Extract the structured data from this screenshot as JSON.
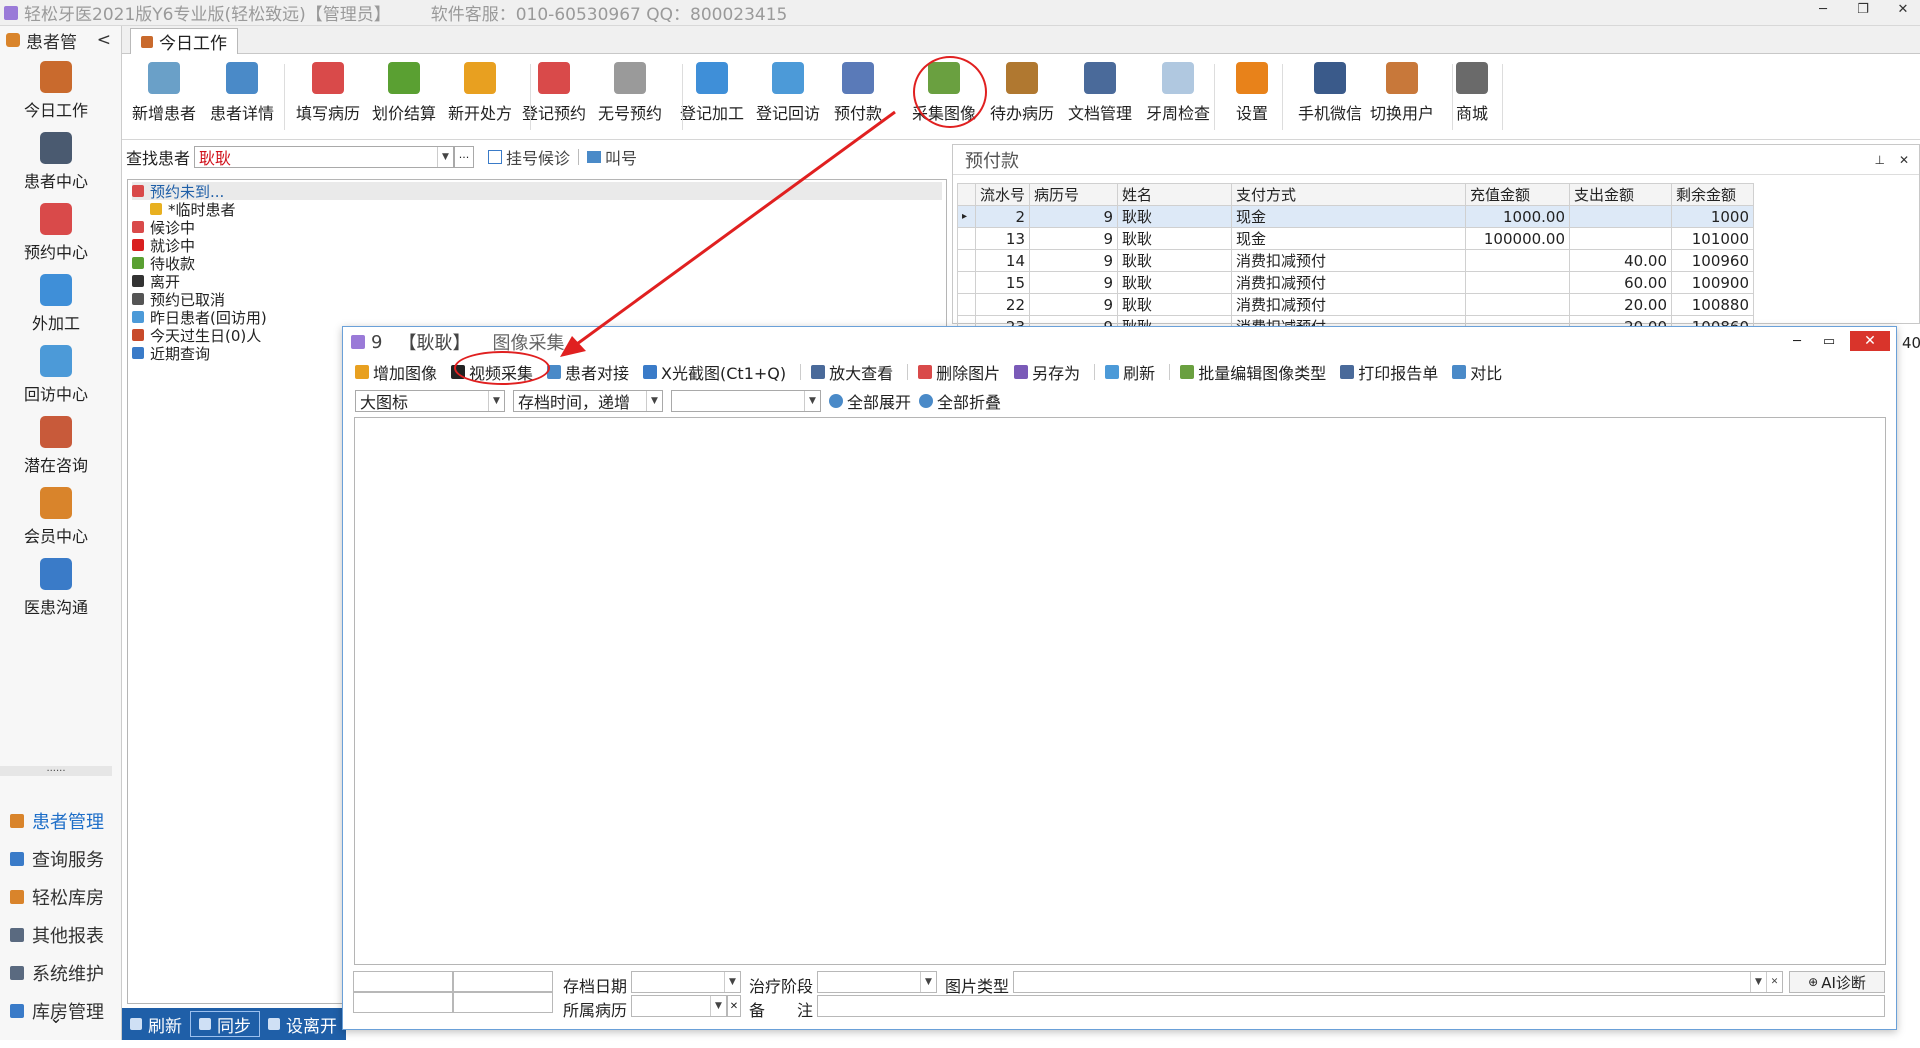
{
  "app": {
    "title": "轻松牙医2021版Y6专业版(轻松致远)【管理员】",
    "support": "软件客服：010-60530967 QQ：800023415",
    "window_controls": [
      "─",
      "❐",
      "✕"
    ]
  },
  "left_panel": {
    "header": "患者管",
    "header_arrow": "<",
    "nav_big": [
      {
        "label": "今日工作",
        "icon": "worker-icon",
        "color": "#c96a2d"
      },
      {
        "label": "患者中心",
        "icon": "binoculars-icon",
        "color": "#4a5a70"
      },
      {
        "label": "预约中心",
        "icon": "calendar-icon",
        "color": "#d94a4a"
      },
      {
        "label": "外加工",
        "icon": "cubes-icon",
        "color": "#3f8fd8"
      },
      {
        "label": "回访中心",
        "icon": "refresh-icon",
        "color": "#4c9ad8"
      },
      {
        "label": "潜在咨询",
        "icon": "consult-icon",
        "color": "#c85a3a"
      },
      {
        "label": "会员中心",
        "icon": "members-icon",
        "color": "#d9842b"
      },
      {
        "label": "医患沟通",
        "icon": "film-icon",
        "color": "#3a7bc8"
      }
    ],
    "dots": "......",
    "nav_small": [
      {
        "label": "患者管理",
        "icon": "people-icon",
        "color": "#d9842b",
        "active": true
      },
      {
        "label": "查询服务",
        "icon": "query-icon",
        "color": "#3a7bc8"
      },
      {
        "label": "轻松库房",
        "icon": "warehouse-icon",
        "color": "#d9842b"
      },
      {
        "label": "其他报表",
        "icon": "report-icon",
        "color": "#5a6a80"
      },
      {
        "label": "系统维护",
        "icon": "maintenance-icon",
        "color": "#5a6a80"
      },
      {
        "label": "库房管理",
        "icon": "stock-icon",
        "color": "#3a7bc8"
      }
    ],
    "bottom_arrow": "⌄"
  },
  "tabs": [
    {
      "label": "今日工作"
    }
  ],
  "ribbon": [
    {
      "label": "新增患者",
      "icon": "add-patient-icon",
      "color": "#6aa0c8"
    },
    {
      "label": "患者详情",
      "icon": "patient-detail-icon",
      "color": "#4a8ac8"
    },
    {
      "label": "填写病历",
      "icon": "medical-record-icon",
      "color": "#d94a4a"
    },
    {
      "label": "划价结算",
      "icon": "yen-icon",
      "color": "#5aa032"
    },
    {
      "label": "新开处方",
      "icon": "pill-icon",
      "color": "#e8a020"
    },
    {
      "label": "登记预约",
      "icon": "calendar-icon",
      "color": "#d94a4a"
    },
    {
      "label": "无号预约",
      "icon": "calendar-grid-icon",
      "color": "#9a9a9a"
    },
    {
      "label": "登记加工",
      "icon": "cubes-icon",
      "color": "#3f8fd8"
    },
    {
      "label": "登记回访",
      "icon": "refresh-icon",
      "color": "#4c9ad8"
    },
    {
      "label": "预付款",
      "icon": "prepay-icon",
      "color": "#5a7ab8"
    },
    {
      "label": "采集图像",
      "icon": "image-icon",
      "color": "#6aa040"
    },
    {
      "label": "待办病历",
      "icon": "checklist-icon",
      "color": "#b07830"
    },
    {
      "label": "文档管理",
      "icon": "document-icon",
      "color": "#4a6a9a"
    },
    {
      "label": "牙周检查",
      "icon": "tooth-icon",
      "color": "#b0c8e0"
    },
    {
      "label": "设置",
      "icon": "rss-settings-icon",
      "color": "#e8821a"
    },
    {
      "label": "手机微信",
      "icon": "phone-icon",
      "color": "#3a5a8a"
    },
    {
      "label": "切换用户",
      "icon": "switch-user-icon",
      "color": "#c8783a"
    },
    {
      "label": "商城",
      "icon": "cart-icon",
      "color": "#6a6a6a"
    }
  ],
  "find": {
    "label": "查找患者",
    "value": "耿耿",
    "dropdown": "▼",
    "ellipsis": "···",
    "queue": "挂号候诊",
    "call": "叫号"
  },
  "tree": [
    {
      "label": "预约未到...",
      "icon": "appointment-icon",
      "color": "#d94a4a",
      "selected": true,
      "indent": false
    },
    {
      "label": "*临时患者",
      "icon": "smiley-icon",
      "color": "#e8b020",
      "indent": true
    },
    {
      "label": "候诊中",
      "icon": "waiting-icon",
      "color": "#d94a4a",
      "indent": false
    },
    {
      "label": "就诊中",
      "icon": "visiting-icon",
      "color": "#d92020",
      "indent": false
    },
    {
      "label": "待收款",
      "icon": "yen-icon",
      "color": "#5aa032",
      "indent": false
    },
    {
      "label": "离开",
      "icon": "walking-icon",
      "color": "#333333",
      "indent": false
    },
    {
      "label": "预约已取消",
      "icon": "cancel-calendar-icon",
      "color": "#555555",
      "indent": false
    },
    {
      "label": "昨日患者(回访用)",
      "icon": "loop-icon",
      "color": "#4c9ad8",
      "indent": false
    },
    {
      "label": "今天过生日(0)人",
      "icon": "cake-icon",
      "color": "#c84a2a",
      "indent": false
    },
    {
      "label": "近期查询",
      "icon": "search-icon",
      "color": "#3a7bc8",
      "indent": false
    }
  ],
  "bottom_bar": [
    {
      "label": "刷新",
      "icon": "refresh-icon"
    },
    {
      "label": "同步",
      "icon": "sync-icon",
      "selected": true
    },
    {
      "label": "设离开",
      "icon": "walking-icon"
    }
  ],
  "prepay": {
    "title": "预付款",
    "pin": "⊥",
    "close": "✕",
    "columns": [
      "流水号",
      "病历号",
      "姓名",
      "支付方式",
      "充值金额",
      "支出金额",
      "剩余金额"
    ],
    "rows": [
      [
        "2",
        "9",
        "耿耿",
        "现金",
        "1000.00",
        "",
        "1000"
      ],
      [
        "13",
        "9",
        "耿耿",
        "现金",
        "100000.00",
        "",
        "101000"
      ],
      [
        "14",
        "9",
        "耿耿",
        "消费扣减预付",
        "",
        "40.00",
        "100960"
      ],
      [
        "15",
        "9",
        "耿耿",
        "消费扣减预付",
        "",
        "60.00",
        "100900"
      ],
      [
        "22",
        "9",
        "耿耿",
        "消费扣减预付",
        "",
        "20.00",
        "100880"
      ],
      [
        "23",
        "9",
        "耿耿",
        "消费扣减预付",
        "",
        "20.00",
        "100860"
      ]
    ],
    "row_marker": "▸",
    "overflow_value": "40"
  },
  "dialog": {
    "title_id": "9",
    "title_name": "【耿耿】",
    "title_text": "图像采集",
    "controls": {
      "min": "─",
      "max": "▭",
      "close": "✕"
    },
    "tools": [
      {
        "label": "增加图像",
        "icon": "folder-open-icon",
        "color": "#e8a020"
      },
      {
        "label": "视频采集",
        "icon": "video-icon",
        "color": "#222222"
      },
      {
        "label": "患者对接",
        "icon": "link-icon",
        "color": "#4a8ac8"
      },
      {
        "label": "X光截图(Ct1+Q)",
        "icon": "xray-icon",
        "color": "#3a7bc8"
      },
      {
        "label": "放大查看",
        "icon": "zoom-icon",
        "color": "#4a6a9a"
      },
      {
        "label": "删除图片",
        "icon": "delete-image-icon",
        "color": "#d94a4a"
      },
      {
        "label": "另存为",
        "icon": "save-as-icon",
        "color": "#7a5ab8"
      },
      {
        "label": "刷新",
        "icon": "refresh-icon",
        "color": "#4c9ad8"
      },
      {
        "label": "批量编辑图像类型",
        "icon": "batch-edit-icon",
        "color": "#6aa040"
      },
      {
        "label": "打印报告单",
        "icon": "print-icon",
        "color": "#4a6a9a"
      },
      {
        "label": "对比",
        "icon": "compare-icon",
        "color": "#4a8ac8"
      }
    ],
    "view_mode": "大图标",
    "sort_mode": "存档时间，递增",
    "filter": "",
    "expand_all": "全部展开",
    "collapse_all": "全部折叠",
    "bottom": {
      "archive_date_label": "存档日期",
      "stage_label": "治疗阶段",
      "image_type_label": "图片类型",
      "ai_button": "AI诊断",
      "record_label": "所属病历",
      "note_label": "备　　注"
    }
  },
  "annotation": {
    "color": "#e02020"
  }
}
